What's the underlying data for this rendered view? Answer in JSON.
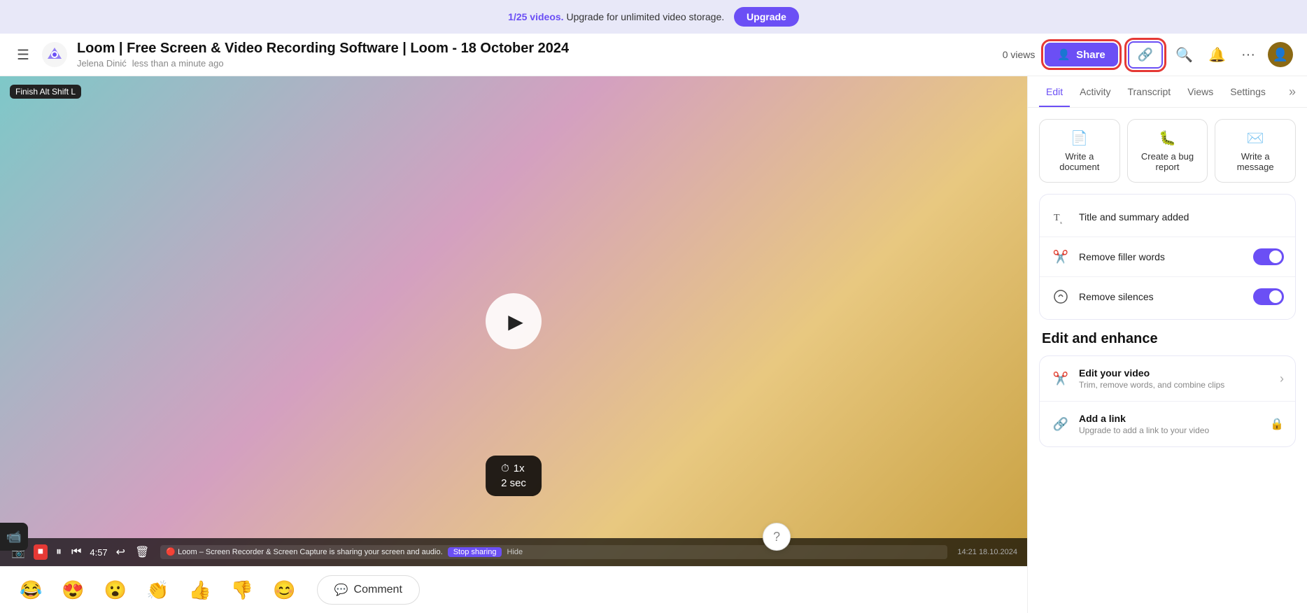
{
  "banner": {
    "text": "1/25 videos.",
    "text2": " Upgrade for unlimited video storage.",
    "upgrade_label": "Upgrade"
  },
  "header": {
    "title": "Loom | Free Screen & Video Recording Software | Loom - 18 October 2024",
    "author": "Jelena Dinić",
    "time": "less than a minute ago",
    "views": "0 views",
    "share_label": "Share"
  },
  "tabs": {
    "items": [
      "Edit",
      "Activity",
      "Transcript",
      "Views",
      "Settings"
    ]
  },
  "ai_actions": {
    "cards": [
      {
        "icon": "📄",
        "label": "Write a document"
      },
      {
        "icon": "🐛",
        "label": "Create a bug report"
      },
      {
        "icon": "✉️",
        "label": "Write a message"
      }
    ]
  },
  "features": {
    "rows": [
      {
        "icon": "Tᵢ",
        "label": "Title and summary added",
        "has_toggle": false
      },
      {
        "icon": "✂️",
        "label": "Remove filler words",
        "has_toggle": true,
        "toggle_on": true
      },
      {
        "icon": "🔇",
        "label": "Remove silences",
        "has_toggle": true,
        "toggle_on": true
      }
    ]
  },
  "edit_enhance": {
    "title": "Edit and enhance",
    "rows": [
      {
        "icon": "✂️",
        "label": "Edit your video",
        "sub": "Trim, remove words, and combine clips",
        "has_arrow": true,
        "has_lock": false
      },
      {
        "icon": "🔗",
        "label": "Add a link",
        "sub": "Upgrade to add a link to your video",
        "has_arrow": false,
        "has_lock": true
      }
    ]
  },
  "video": {
    "speed": "1x",
    "time_elapsed": "2 sec",
    "duration": "4:57"
  },
  "reactions": {
    "emojis": [
      "😂",
      "😍",
      "😮",
      "👏",
      "👍",
      "👎",
      "😊"
    ],
    "comment_label": "Comment"
  }
}
